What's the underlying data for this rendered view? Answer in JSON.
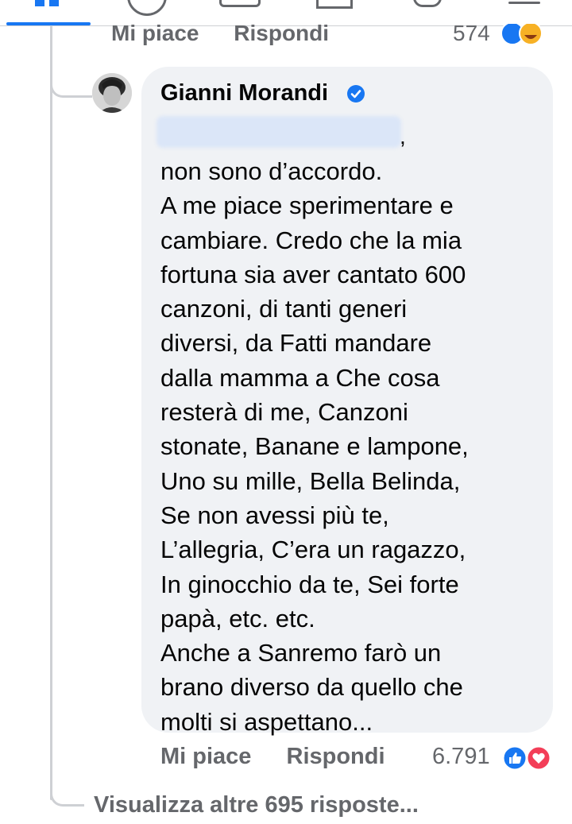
{
  "previous_comment": {
    "like_label": "Mi piace",
    "reply_label": "Rispondi",
    "reaction_count": "574"
  },
  "comment": {
    "author": "Gianni Morandi",
    "verified": true,
    "text": "non sono d’accordo.\nA me piace sperimentare e\ncambiare. Credo che la mia\nfortuna sia aver cantato 600\ncanzoni, di tanti generi\ndiversi, da Fatti mandare\ndalla mamma a Che cosa\nresterà di me, Canzoni\nstonate, Banane e lampone,\nUno su mille, Bella Belinda,\nSe non avessi più te,\nL’allegria,  C’era un ragazzo,\nIn ginocchio da te, Sei forte\npapà, etc. etc.\nAnche a Sanremo farò un\nbrano diverso da quello che\nmolti si aspettano...",
    "like_label": "Mi piace",
    "reply_label": "Rispondi",
    "reaction_count": "6.791",
    "reactions": [
      "like-icon",
      "love-icon"
    ]
  },
  "more_replies_label": "Visualizza altre 695 risposte...",
  "colors": {
    "accent": "#1877f2",
    "bubble": "#f0f2f5",
    "secondary_text": "#65676b",
    "love": "#f33e58"
  }
}
